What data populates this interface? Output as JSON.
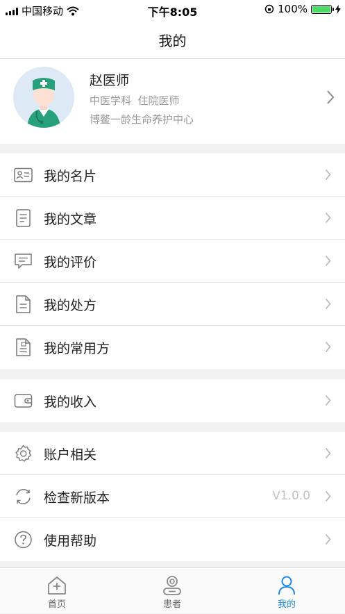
{
  "status_bar": {
    "carrier": "中国移动",
    "time": "下午8:05",
    "battery_percent": "100%",
    "battery_level": 1.0
  },
  "nav": {
    "title": "我的"
  },
  "profile": {
    "name": "赵医师",
    "department": "中医学科  住院医师",
    "organization": "博鳌一龄生命养护中心",
    "avatar_icon": "doctor-avatar"
  },
  "menu": {
    "group1": [
      {
        "label": "我的名片",
        "icon": "id-card-icon"
      },
      {
        "label": "我的文章",
        "icon": "document-icon"
      },
      {
        "label": "我的评价",
        "icon": "comment-icon"
      },
      {
        "label": "我的处方",
        "icon": "prescription-icon"
      },
      {
        "label": "我的常用方",
        "icon": "common-prescription-icon"
      }
    ],
    "group2": [
      {
        "label": "我的收入",
        "icon": "wallet-icon"
      }
    ],
    "group3": [
      {
        "label": "账户相关",
        "icon": "gear-icon"
      },
      {
        "label": "检查新版本",
        "icon": "refresh-icon",
        "value": "V1.0.0"
      },
      {
        "label": "使用帮助",
        "icon": "help-icon"
      }
    ]
  },
  "tabbar": {
    "tabs": [
      {
        "label": "首页",
        "icon": "home-icon"
      },
      {
        "label": "患者",
        "icon": "patient-icon"
      },
      {
        "label": "我的",
        "icon": "profile-icon",
        "active": true
      }
    ],
    "active_color": "#1e88e5"
  }
}
